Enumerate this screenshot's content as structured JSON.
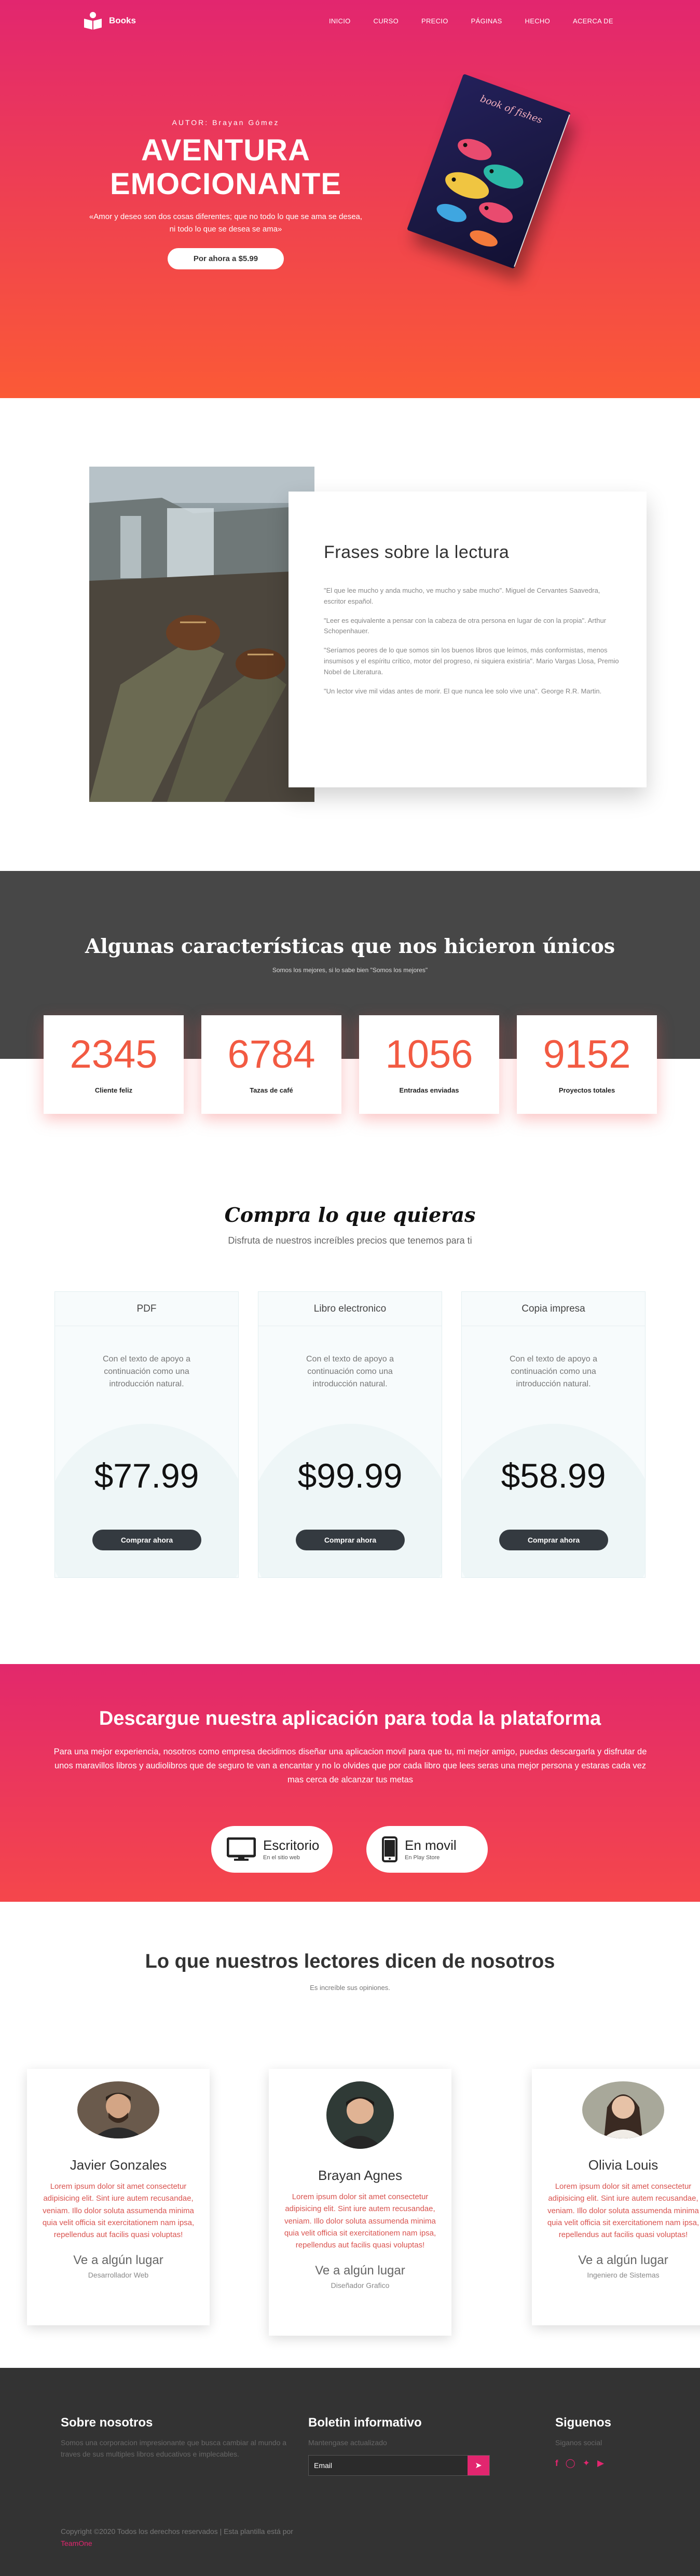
{
  "nav": {
    "brand": "Books",
    "items": [
      "INICIO",
      "CURSO",
      "PRECIO",
      "PÁGINAS",
      "HECHO",
      "ACERCA DE"
    ]
  },
  "hero": {
    "author": "AUTOR: Brayan Gómez",
    "title_line1": "AVENTURA",
    "title_line2": "EMOCIONANTE",
    "quote_line1": "«Amor y deseo son dos cosas diferentes; que no todo lo que se ama se desea,",
    "quote_line2": "ni todo lo que se desea se ama»",
    "button": "Por ahora a $5.99",
    "book_title": "book of fishes"
  },
  "quotes": {
    "title": "Frases sobre la lectura",
    "items": [
      "\"El que lee mucho y anda mucho, ve mucho y sabe mucho\". Miguel de Cervantes Saavedra, escritor español.",
      "\"Leer es equivalente a pensar con la cabeza de otra persona en lugar de con la propia\". Arthur Schopenhauer.",
      "\"Seríamos peores de lo que somos sin los buenos libros que leímos, más conformistas, menos insumisos y el espíritu crítico, motor del progreso, ni siquiera existiría\". Mario Vargas Llosa, Premio Nobel de Literatura.",
      "\"Un lector vive mil vidas antes de morir. El que nunca lee solo vive una\". George R.R. Martin."
    ]
  },
  "features": {
    "title": "Algunas características que nos hicieron únicos",
    "subtitle": "Somos los mejores, si lo sabe bien \"Somos los mejores\"",
    "stats": [
      {
        "value": "2345",
        "label": "Cliente feliz"
      },
      {
        "value": "6784",
        "label": "Tazas de café"
      },
      {
        "value": "1056",
        "label": "Entradas enviadas"
      },
      {
        "value": "9152",
        "label": "Proyectos totales"
      }
    ]
  },
  "pricing": {
    "title": "Compra lo que quieras",
    "subtitle": "Disfruta de nuestros increíbles precios que tenemos para ti",
    "plans": [
      {
        "name": "PDF",
        "desc": "Con el texto de apoyo a continuación como una introducción natural.",
        "price": "$77.99",
        "button": "Comprar ahora"
      },
      {
        "name": "Libro electronico",
        "desc": "Con el texto de apoyo a continuación como una introducción natural.",
        "price": "$99.99",
        "button": "Comprar ahora"
      },
      {
        "name": "Copia impresa",
        "desc": "Con el texto de apoyo a continuación como una introducción natural.",
        "price": "$58.99",
        "button": "Comprar ahora"
      }
    ]
  },
  "download": {
    "title": "Descargue nuestra aplicación para toda la plataforma",
    "text": "Para una mejor experiencia, nosotros como empresa decidimos diseñar una aplicacion movil para que tu, mi mejor amigo, puedas descargarla y disfrutar de unos maravillos libros y audiolibros que de seguro te van a encantar y no lo olvides que por cada libro que lees seras una mejor persona y estaras cada vez mas cerca de alcanzar tus metas",
    "desktop": {
      "label": "Escritorio",
      "sub": "En el sitio web"
    },
    "mobile": {
      "label": "En movil",
      "sub": "En Play Store"
    }
  },
  "reviews": {
    "title": "Lo que nuestros lectores dicen de nosotros",
    "subtitle": "Es increíble sus opiniones.",
    "items": [
      {
        "name": "Javier Gonzales",
        "text": "Lorem ipsum dolor sit amet consectetur adipisicing elit. Sint iure autem recusandae, veniam. Illo dolor soluta assumenda minima quia velit officia sit exercitationem nam ipsa, repellendus aut facilis quasi voluptas!",
        "place": "Ve a algún lugar",
        "role": "Desarrollador Web"
      },
      {
        "name": "Brayan Agnes",
        "text": "Lorem ipsum dolor sit amet consectetur adipisicing elit. Sint iure autem recusandae, veniam. Illo dolor soluta assumenda minima quia velit officia sit exercitationem nam ipsa, repellendus aut facilis quasi voluptas!",
        "place": "Ve a algún lugar",
        "role": "Diseñador Grafico"
      },
      {
        "name": "Olivia Louis",
        "text": "Lorem ipsum dolor sit amet consectetur adipisicing elit. Sint iure autem recusandae, veniam. Illo dolor soluta assumenda minima quia velit officia sit exercitationem nam ipsa, repellendus aut facilis quasi voluptas!",
        "place": "Ve a algún lugar",
        "role": "Ingeniero de Sistemas"
      }
    ]
  },
  "footer": {
    "about_title": "Sobre nosotros",
    "about_text": "Somos una corporacion impresionante que busca cambiar al mundo a traves de sus multiples libros educativos e implecables.",
    "news_title": "Boletin informativo",
    "news_text": "Mantengase actualizado",
    "email_placeholder": "Email",
    "follow_title": "Siguenos",
    "follow_text": "Siganos social",
    "copyright": "Copyright ©2020 Todos los derechos reservados | Esta plantilla está por",
    "copyright_link": "TeamOne"
  },
  "colors": {
    "accent": "#e2266f",
    "orange": "#f25a42",
    "dark": "#343a40"
  }
}
